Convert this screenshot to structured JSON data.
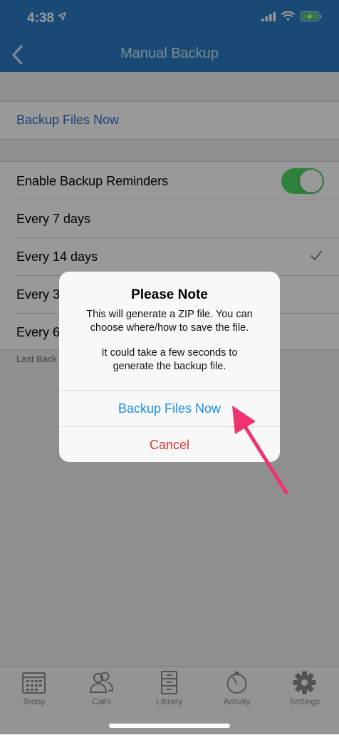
{
  "status_bar": {
    "time": "4:38"
  },
  "nav": {
    "title": "Manual Backup"
  },
  "backup_now_row": {
    "label": "Backup Files Now"
  },
  "settings": {
    "reminders_label": "Enable Backup Reminders",
    "reminders_enabled": true,
    "options": [
      "Every 7 days",
      "Every 14 days",
      "Every 3",
      "Every 6"
    ],
    "selected_option": "Every 14 days",
    "footer_note": "Last Back"
  },
  "dialog": {
    "title": "Please Note",
    "message_1": "This will generate a ZIP file. You can",
    "message_2": "choose where/how to save the file.",
    "message_3": "It could take a few seconds to",
    "message_4": "generate the backup file.",
    "primary_button": "Backup Files Now",
    "cancel_button": "Cancel"
  },
  "tabbar": {
    "tabs": [
      {
        "label": "Today",
        "icon": "calendar-icon"
      },
      {
        "label": "Calls",
        "icon": "people-icon"
      },
      {
        "label": "Library",
        "icon": "file-cabinet-icon"
      },
      {
        "label": "Activity",
        "icon": "timer-icon"
      },
      {
        "label": "Settings",
        "icon": "gear-icon"
      }
    ]
  },
  "colors": {
    "nav_bar": "#2a7bc4",
    "link_blue": "#2b72c2",
    "dialog_blue": "#1a8de0",
    "cancel_red": "#e0332a",
    "toggle_green": "#4bd763",
    "annotation_arrow": "#f0336f"
  }
}
